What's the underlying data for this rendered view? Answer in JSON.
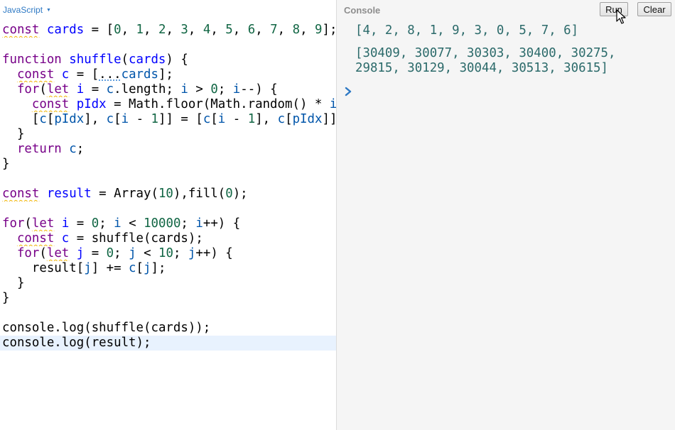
{
  "editor": {
    "language": "JavaScript",
    "code": [
      {
        "segs": [
          [
            "kw squig",
            "const"
          ],
          [
            "var",
            " "
          ],
          [
            "def",
            "cards"
          ],
          [
            "var",
            " = ["
          ],
          [
            "num",
            "0"
          ],
          [
            "var",
            ", "
          ],
          [
            "num",
            "1"
          ],
          [
            "var",
            ", "
          ],
          [
            "num",
            "2"
          ],
          [
            "var",
            ", "
          ],
          [
            "num",
            "3"
          ],
          [
            "var",
            ", "
          ],
          [
            "num",
            "4"
          ],
          [
            "var",
            ", "
          ],
          [
            "num",
            "5"
          ],
          [
            "var",
            ", "
          ],
          [
            "num",
            "6"
          ],
          [
            "var",
            ", "
          ],
          [
            "num",
            "7"
          ],
          [
            "var",
            ", "
          ],
          [
            "num",
            "8"
          ],
          [
            "var",
            ", "
          ],
          [
            "num",
            "9"
          ],
          [
            "var",
            "];"
          ]
        ]
      },
      {
        "segs": []
      },
      {
        "segs": [
          [
            "kw",
            "function"
          ],
          [
            "var",
            " "
          ],
          [
            "def",
            "shuffle"
          ],
          [
            "var",
            "("
          ],
          [
            "def",
            "cards"
          ],
          [
            "var",
            ") {"
          ]
        ]
      },
      {
        "segs": [
          [
            "var",
            "  "
          ],
          [
            "kw squig",
            "const"
          ],
          [
            "var",
            " "
          ],
          [
            "def",
            "c"
          ],
          [
            "var",
            " = ["
          ],
          [
            "var dotted",
            "..."
          ],
          [
            "vd",
            "cards"
          ],
          [
            "var",
            "];"
          ]
        ]
      },
      {
        "segs": [
          [
            "var",
            "  "
          ],
          [
            "kw",
            "for"
          ],
          [
            "var",
            "("
          ],
          [
            "kw squig",
            "let"
          ],
          [
            "var",
            " "
          ],
          [
            "def",
            "i"
          ],
          [
            "var",
            " = "
          ],
          [
            "vd",
            "c"
          ],
          [
            "var",
            "."
          ],
          [
            "prop",
            "length"
          ],
          [
            "var",
            "; "
          ],
          [
            "vd",
            "i"
          ],
          [
            "var",
            " > "
          ],
          [
            "num",
            "0"
          ],
          [
            "var",
            "; "
          ],
          [
            "vd",
            "i"
          ],
          [
            "var",
            "--) {"
          ]
        ]
      },
      {
        "segs": [
          [
            "var",
            "    "
          ],
          [
            "kw squig",
            "const"
          ],
          [
            "var",
            " "
          ],
          [
            "def",
            "pIdx"
          ],
          [
            "var",
            " = "
          ],
          [
            "var",
            "Math"
          ],
          [
            "var",
            "."
          ],
          [
            "prop",
            "floor"
          ],
          [
            "var",
            "("
          ],
          [
            "var",
            "Math"
          ],
          [
            "var",
            "."
          ],
          [
            "prop",
            "random"
          ],
          [
            "var",
            "() * "
          ],
          [
            "vd",
            "i"
          ],
          [
            "var",
            ");"
          ]
        ]
      },
      {
        "segs": [
          [
            "var",
            "    ["
          ],
          [
            "vd",
            "c"
          ],
          [
            "var",
            "["
          ],
          [
            "vd",
            "pIdx"
          ],
          [
            "var",
            "], "
          ],
          [
            "vd",
            "c"
          ],
          [
            "var",
            "["
          ],
          [
            "vd",
            "i"
          ],
          [
            "var",
            " - "
          ],
          [
            "num",
            "1"
          ],
          [
            "var",
            "]] = ["
          ],
          [
            "vd",
            "c"
          ],
          [
            "var",
            "["
          ],
          [
            "vd",
            "i"
          ],
          [
            "var",
            " - "
          ],
          [
            "num",
            "1"
          ],
          [
            "var",
            "], "
          ],
          [
            "vd",
            "c"
          ],
          [
            "var",
            "["
          ],
          [
            "vd",
            "pIdx"
          ],
          [
            "var",
            "]];"
          ]
        ]
      },
      {
        "segs": [
          [
            "var",
            "  }"
          ]
        ]
      },
      {
        "segs": [
          [
            "var",
            "  "
          ],
          [
            "kw",
            "return"
          ],
          [
            "var",
            " "
          ],
          [
            "vd",
            "c"
          ],
          [
            "var",
            ";"
          ]
        ]
      },
      {
        "segs": [
          [
            "var",
            "}"
          ]
        ]
      },
      {
        "segs": []
      },
      {
        "segs": [
          [
            "kw squig",
            "const"
          ],
          [
            "var",
            " "
          ],
          [
            "def",
            "result"
          ],
          [
            "var",
            " = "
          ],
          [
            "var",
            "Array"
          ],
          [
            "var",
            "("
          ],
          [
            "num",
            "10"
          ],
          [
            "var",
            "),"
          ],
          [
            "prop",
            "fill"
          ],
          [
            "var",
            "("
          ],
          [
            "num",
            "0"
          ],
          [
            "var",
            ");"
          ]
        ]
      },
      {
        "segs": []
      },
      {
        "segs": [
          [
            "kw",
            "for"
          ],
          [
            "var",
            "("
          ],
          [
            "kw squig",
            "let"
          ],
          [
            "var",
            " "
          ],
          [
            "def",
            "i"
          ],
          [
            "var",
            " = "
          ],
          [
            "num",
            "0"
          ],
          [
            "var",
            "; "
          ],
          [
            "vd",
            "i"
          ],
          [
            "var",
            " < "
          ],
          [
            "num",
            "10000"
          ],
          [
            "var",
            "; "
          ],
          [
            "vd",
            "i"
          ],
          [
            "var",
            "++) {"
          ]
        ]
      },
      {
        "segs": [
          [
            "var",
            "  "
          ],
          [
            "kw squig",
            "const"
          ],
          [
            "var",
            " "
          ],
          [
            "def",
            "c"
          ],
          [
            "var",
            " = "
          ],
          [
            "var",
            "shuffle"
          ],
          [
            "var",
            "("
          ],
          [
            "var",
            "cards"
          ],
          [
            "var",
            ");"
          ]
        ]
      },
      {
        "segs": [
          [
            "var",
            "  "
          ],
          [
            "kw",
            "for"
          ],
          [
            "var",
            "("
          ],
          [
            "kw squig",
            "let"
          ],
          [
            "var",
            " "
          ],
          [
            "def",
            "j"
          ],
          [
            "var",
            " = "
          ],
          [
            "num",
            "0"
          ],
          [
            "var",
            "; "
          ],
          [
            "vd",
            "j"
          ],
          [
            "var",
            " < "
          ],
          [
            "num",
            "10"
          ],
          [
            "var",
            "; "
          ],
          [
            "vd",
            "j"
          ],
          [
            "var",
            "++) {"
          ]
        ]
      },
      {
        "segs": [
          [
            "var",
            "    "
          ],
          [
            "var",
            "result"
          ],
          [
            "var",
            "["
          ],
          [
            "vd",
            "j"
          ],
          [
            "var",
            "] += "
          ],
          [
            "vd",
            "c"
          ],
          [
            "var",
            "["
          ],
          [
            "vd",
            "j"
          ],
          [
            "var",
            "];"
          ]
        ]
      },
      {
        "segs": [
          [
            "var",
            "  }"
          ]
        ]
      },
      {
        "segs": [
          [
            "var",
            "}"
          ]
        ]
      },
      {
        "segs": []
      },
      {
        "segs": [
          [
            "var",
            "console"
          ],
          [
            "var",
            "."
          ],
          [
            "prop",
            "log"
          ],
          [
            "var",
            "("
          ],
          [
            "var",
            "shuffle"
          ],
          [
            "var",
            "("
          ],
          [
            "var",
            "cards"
          ],
          [
            "var",
            "));"
          ]
        ]
      },
      {
        "segs": [
          [
            "var",
            "console"
          ],
          [
            "var",
            "."
          ],
          [
            "prop",
            "log"
          ],
          [
            "var",
            "("
          ],
          [
            "var",
            "result"
          ],
          [
            "var",
            ");"
          ]
        ],
        "active": true
      }
    ]
  },
  "console": {
    "title": "Console",
    "run_label": "Run",
    "clear_label": "Clear",
    "outputs": [
      "[4, 2, 8, 1, 9, 3, 0, 5, 7, 6]",
      "[30409, 30077, 30303, 30400, 30275,\n29815, 30129, 30044, 30513, 30615]"
    ]
  },
  "colors": {
    "keyword": "#770088",
    "definition": "#0000ff",
    "number": "#116644",
    "console_output": "#2b6a6a",
    "accent": "#2e79c4"
  },
  "icons": {
    "language_caret": "chevron-down-icon",
    "console_prompt": "chevron-right-icon",
    "mouse_cursor": "mouse-pointer-icon"
  }
}
